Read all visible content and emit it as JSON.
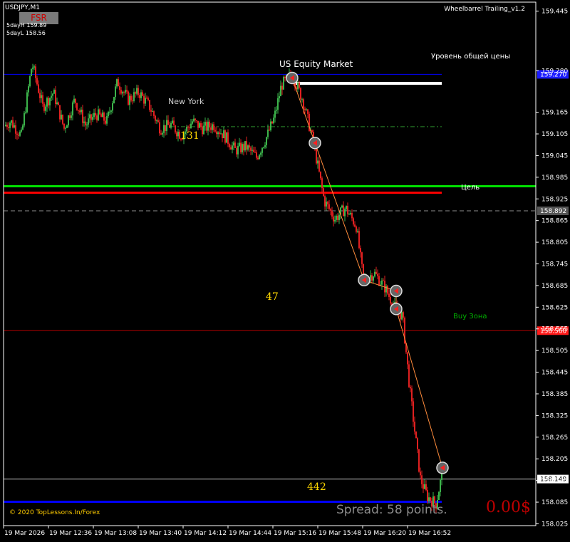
{
  "window": {
    "symbol": "USDJPY,M1",
    "indicator_badge": "FSR",
    "day_high": "5dayH 159.89",
    "day_low": "5dayL 158.56",
    "expert": "Wheelbarrel Trailing_v1.2",
    "copyright": "© 2020 TopLessons.In/Forex",
    "spread": "Spread: 58 points.",
    "profit": "0.00$"
  },
  "annotations": {
    "us_equity": "US Equity Market",
    "new_york": "New York",
    "general_price_level": "Уровень общей цены",
    "target": "Цель",
    "buy_zone": "Buy Зона",
    "count_top": "131",
    "count_mid": "47",
    "count_bottom": "442"
  },
  "colors": {
    "background": "#000000",
    "bull_candle": "#3cb44b",
    "bear_candle": "#e02020",
    "level_green": "#00e000",
    "level_red": "#ff0000",
    "level_blue": "#0000ff",
    "level_dark_red": "#b00000",
    "count_text": "#ffd700"
  },
  "chart_data": {
    "type": "candlestick",
    "symbol": "USDJPY",
    "timeframe": "M1",
    "ylim": [
      158.02,
      159.47
    ],
    "y_ticks": [
      "159.445",
      "159.280",
      "159.165",
      "159.105",
      "159.045",
      "158.985",
      "158.925",
      "158.865",
      "158.805",
      "158.745",
      "158.685",
      "158.625",
      "158.565",
      "158.505",
      "158.445",
      "158.385",
      "158.325",
      "158.265",
      "158.205",
      "158.145",
      "158.085",
      "158.025"
    ],
    "x_ticks": [
      "19 Mar 2026",
      "19 Mar 12:36",
      "19 Mar 13:08",
      "19 Mar 13:40",
      "19 Mar 14:12",
      "19 Mar 14:44",
      "19 Mar 15:16",
      "19 Mar 15:48",
      "19 Mar 16:20",
      "19 Mar 16:52"
    ],
    "close_path": [
      [
        0,
        159.12
      ],
      [
        15,
        159.14
      ],
      [
        30,
        159.1
      ],
      [
        45,
        159.3
      ],
      [
        60,
        159.18
      ],
      [
        75,
        159.22
      ],
      [
        90,
        159.12
      ],
      [
        105,
        159.2
      ],
      [
        120,
        159.13
      ],
      [
        135,
        159.16
      ],
      [
        150,
        159.14
      ],
      [
        165,
        159.25
      ],
      [
        180,
        159.2
      ],
      [
        195,
        159.22
      ],
      [
        210,
        159.18
      ],
      [
        225,
        159.12
      ],
      [
        240,
        159.13
      ],
      [
        255,
        159.1
      ],
      [
        270,
        159.14
      ],
      [
        285,
        159.12
      ],
      [
        300,
        159.13
      ],
      [
        315,
        159.1
      ],
      [
        330,
        159.06
      ],
      [
        345,
        159.07
      ],
      [
        360,
        159.04
      ],
      [
        375,
        159.1
      ],
      [
        385,
        159.15
      ],
      [
        395,
        159.24
      ],
      [
        410,
        159.27
      ],
      [
        425,
        159.2
      ],
      [
        440,
        159.08
      ],
      [
        455,
        158.92
      ],
      [
        470,
        158.87
      ],
      [
        485,
        158.9
      ],
      [
        500,
        158.85
      ],
      [
        510,
        158.7
      ],
      [
        525,
        158.72
      ],
      [
        540,
        158.68
      ],
      [
        555,
        158.62
      ],
      [
        565,
        158.6
      ],
      [
        575,
        158.4
      ],
      [
        590,
        158.15
      ],
      [
        600,
        158.1
      ],
      [
        612,
        158.08
      ],
      [
        620,
        158.16
      ]
    ],
    "levels": [
      {
        "price": 159.27,
        "color": "#0000ff",
        "label": "159.270",
        "label_bg": "#1a1aff"
      },
      {
        "price": 158.96,
        "color": "#00e000"
      },
      {
        "price": 158.942,
        "color": "#ff0000"
      },
      {
        "price": 158.892,
        "color": "#8c8c8c",
        "label": "158.892",
        "label_bg": "#555555",
        "dashed": true
      },
      {
        "price": 158.56,
        "color": "#b00000",
        "label": "158.560",
        "label_bg": "#ff1a1a"
      },
      {
        "price": 158.149,
        "color": "#c8c8c8",
        "label": "158.149",
        "label_bg": "#ffffff"
      },
      {
        "price": 158.086,
        "color": "#0000ff"
      }
    ],
    "markers": [
      {
        "x": 410,
        "price": 159.26
      },
      {
        "x": 442,
        "price": 159.08
      },
      {
        "x": 511,
        "price": 158.7
      },
      {
        "x": 556,
        "price": 158.67
      },
      {
        "x": 556,
        "price": 158.62
      },
      {
        "x": 621,
        "price": 158.18
      }
    ]
  }
}
